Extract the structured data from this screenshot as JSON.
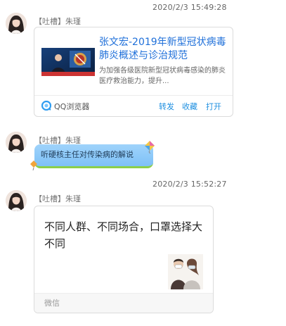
{
  "messages": [
    {
      "timestamp": "2020/2/3 15:49:28",
      "sender": "【吐槽】朱瑾",
      "card": {
        "title": "张文宏-2019年新型冠状病毒肺炎概述与诊治规范",
        "description": "为加强各级医院新型冠状病毒感染的肺炎医疗救治能力，提升...",
        "source": "QQ浏览器",
        "actions": [
          "转发",
          "收藏",
          "打开"
        ]
      }
    },
    {
      "sender": "【吐槽】朱瑾",
      "bubble_text": "听硬核主任对传染病的解说"
    },
    {
      "timestamp": "2020/2/3 15:52:27",
      "sender": "【吐槽】朱瑾",
      "card": {
        "text": "不同人群、不同场合，口罩选择大不同",
        "source": "微信"
      }
    }
  ],
  "colors": {
    "link": "#1e6fd9",
    "action": "#1e8fe0",
    "bubble": "#8ecbf9",
    "bubble_underline": "#8ccf4a"
  }
}
